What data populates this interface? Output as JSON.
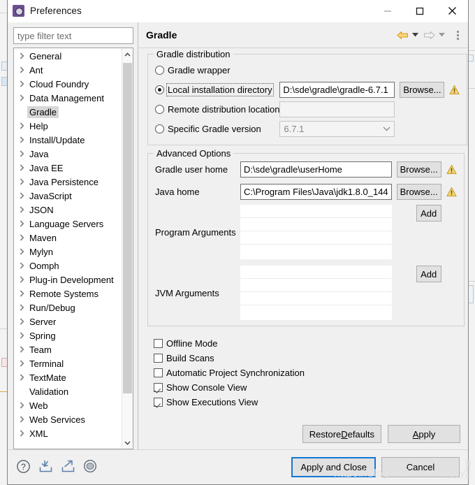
{
  "window": {
    "title": "Preferences",
    "icon": "preferences-gear-icon",
    "minimize": "minimize-icon",
    "maximize": "maximize-icon",
    "close": "close-icon"
  },
  "sidebar": {
    "filter": {
      "placeholder": "type filter text",
      "value": ""
    },
    "items": [
      {
        "label": "General",
        "expandable": true,
        "selected": false
      },
      {
        "label": "Ant",
        "expandable": true,
        "selected": false
      },
      {
        "label": "Cloud Foundry",
        "expandable": true,
        "selected": false
      },
      {
        "label": "Data Management",
        "expandable": true,
        "selected": false
      },
      {
        "label": "Gradle",
        "expandable": false,
        "selected": true
      },
      {
        "label": "Help",
        "expandable": true,
        "selected": false
      },
      {
        "label": "Install/Update",
        "expandable": true,
        "selected": false
      },
      {
        "label": "Java",
        "expandable": true,
        "selected": false
      },
      {
        "label": "Java EE",
        "expandable": true,
        "selected": false
      },
      {
        "label": "Java Persistence",
        "expandable": true,
        "selected": false
      },
      {
        "label": "JavaScript",
        "expandable": true,
        "selected": false
      },
      {
        "label": "JSON",
        "expandable": true,
        "selected": false
      },
      {
        "label": "Language Servers",
        "expandable": true,
        "selected": false
      },
      {
        "label": "Maven",
        "expandable": true,
        "selected": false
      },
      {
        "label": "Mylyn",
        "expandable": true,
        "selected": false
      },
      {
        "label": "Oomph",
        "expandable": true,
        "selected": false
      },
      {
        "label": "Plug-in Development",
        "expandable": true,
        "selected": false
      },
      {
        "label": "Remote Systems",
        "expandable": true,
        "selected": false
      },
      {
        "label": "Run/Debug",
        "expandable": true,
        "selected": false
      },
      {
        "label": "Server",
        "expandable": true,
        "selected": false
      },
      {
        "label": "Spring",
        "expandable": true,
        "selected": false
      },
      {
        "label": "Team",
        "expandable": true,
        "selected": false
      },
      {
        "label": "Terminal",
        "expandable": true,
        "selected": false
      },
      {
        "label": "TextMate",
        "expandable": true,
        "selected": false
      },
      {
        "label": "Validation",
        "expandable": false,
        "selected": false
      },
      {
        "label": "Web",
        "expandable": true,
        "selected": false
      },
      {
        "label": "Web Services",
        "expandable": true,
        "selected": false
      },
      {
        "label": "XML",
        "expandable": true,
        "selected": false
      }
    ],
    "scroll_up": "scroll-up-arrow",
    "scroll_down": "scroll-down-arrow"
  },
  "content": {
    "title": "Gradle",
    "nav": {
      "back": "back-arrow-icon",
      "back_menu": "back-dropdown-caret",
      "forward": "forward-arrow-icon",
      "forward_menu": "forward-dropdown-caret",
      "overflow": "view-menu-icon"
    },
    "distribution": {
      "legend": "Gradle distribution",
      "options": [
        {
          "label": "Gradle wrapper",
          "selected": false,
          "focused": false
        },
        {
          "label": "Local installation directory",
          "selected": true,
          "focused": true
        },
        {
          "label": "Remote distribution location",
          "selected": false,
          "focused": false
        },
        {
          "label": "Specific Gradle version",
          "selected": false,
          "focused": false
        }
      ],
      "local_dir_value": "D:\\sde\\gradle\\gradle-6.7.1",
      "local_dir_browse": "Browse...",
      "remote_url_value": "",
      "version_value": "6.7.1"
    },
    "advanced": {
      "legend": "Advanced Options",
      "gradle_user_home_label": "Gradle user home",
      "gradle_user_home_value": "D:\\sde\\gradle\\userHome",
      "gradle_user_home_browse": "Browse...",
      "java_home_label": "Java home",
      "java_home_value": "C:\\Program Files\\Java\\jdk1.8.0_144",
      "java_home_browse": "Browse...",
      "program_args_label": "Program Arguments",
      "program_args_items": [],
      "program_args_add": "Add",
      "jvm_args_label": "JVM Arguments",
      "jvm_args_items": [],
      "jvm_args_add": "Add"
    },
    "checkboxes": [
      {
        "label": "Offline Mode",
        "checked": false
      },
      {
        "label": "Build Scans",
        "checked": false
      },
      {
        "label": "Automatic Project Synchronization",
        "checked": false
      },
      {
        "label": "Show Console View",
        "checked": true
      },
      {
        "label": "Show Executions View",
        "checked": true
      }
    ],
    "restore_defaults": "Restore Defaults",
    "restore_defaults_mnemonic": "D",
    "apply": "Apply",
    "apply_mnemonic": "A"
  },
  "footer": {
    "icons": [
      {
        "name": "help-icon"
      },
      {
        "name": "import-icon"
      },
      {
        "name": "export-icon"
      },
      {
        "name": "toggle-icon"
      }
    ],
    "apply_and_close": "Apply and Close",
    "cancel": "Cancel"
  },
  "watermark": {
    "url": "https://blog.csdn.net/sayyy",
    "stamp": "渔\n尼\n亚"
  },
  "colors": {
    "accent_focus": "#1477d4",
    "warning": "#e8b33c",
    "back_arrow": "#e8a317",
    "selection": "#d6d6d6"
  }
}
